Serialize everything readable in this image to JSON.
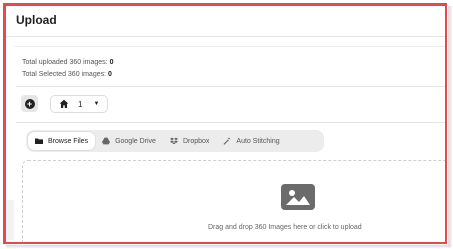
{
  "header": {
    "title": "Upload"
  },
  "stats": {
    "uploaded_label": "Total uploaded 360 images:",
    "uploaded_value": "0",
    "selected_label": "Total Selected 360 images:",
    "selected_value": "0"
  },
  "toolbar": {
    "add_icon": "plus-circle-icon",
    "folder_icon": "home-icon",
    "folder_value": "1",
    "caret_icon": "caret-down-icon"
  },
  "tabs": [
    {
      "label": "Browse Files",
      "icon": "folder-icon",
      "active": true
    },
    {
      "label": "Google Drive",
      "icon": "google-drive-icon",
      "active": false
    },
    {
      "label": "Dropbox",
      "icon": "dropbox-icon",
      "active": false
    },
    {
      "label": "Auto Stitching",
      "icon": "magic-wand-icon",
      "active": false
    }
  ],
  "dropzone": {
    "icon": "image-icon",
    "text": "Drag and drop 360 Images here or click to upload"
  },
  "colors": {
    "frame_border": "#e5484d",
    "icon_gray": "#6b6b6b",
    "tab_track": "#ececec"
  }
}
